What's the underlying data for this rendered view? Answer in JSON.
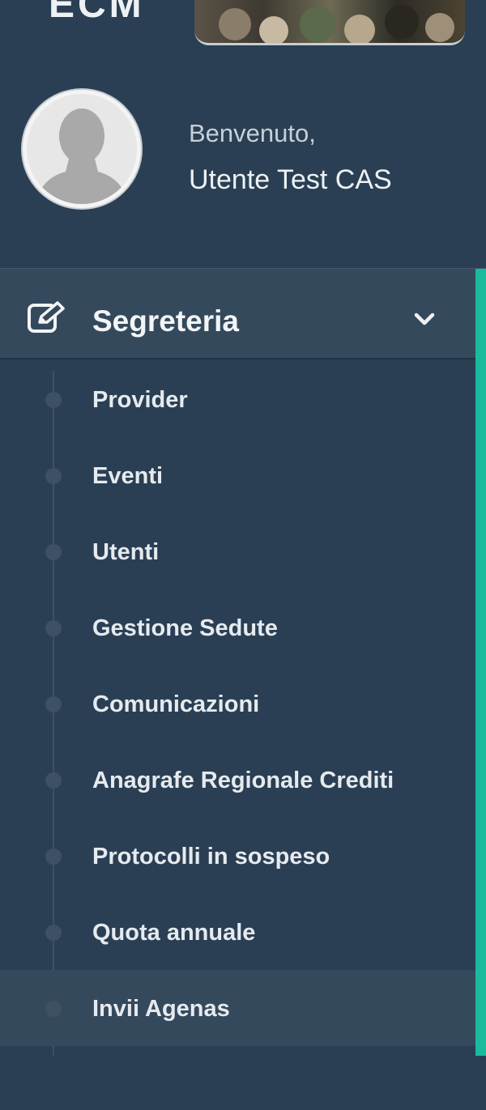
{
  "brand": {
    "logo_text": "ECM"
  },
  "profile": {
    "welcome": "Benvenuto,",
    "username": "Utente Test CAS"
  },
  "menu": {
    "section_title": "Segreteria",
    "section_icon": "edit-icon",
    "expand_icon": "chevron-down-icon",
    "accent_color": "#1abb9c",
    "items": [
      {
        "label": "Provider"
      },
      {
        "label": "Eventi"
      },
      {
        "label": "Utenti"
      },
      {
        "label": "Gestione Sedute"
      },
      {
        "label": "Comunicazioni"
      },
      {
        "label": "Anagrafe Regionale Crediti"
      },
      {
        "label": "Protocolli in sospeso"
      },
      {
        "label": "Quota annuale"
      },
      {
        "label": "Invii Agenas"
      }
    ],
    "active_item": "Invii Agenas"
  },
  "colors": {
    "sidebar_bg": "#2a3f54",
    "header_bg": "#35495d",
    "text": "#e6eaee"
  }
}
